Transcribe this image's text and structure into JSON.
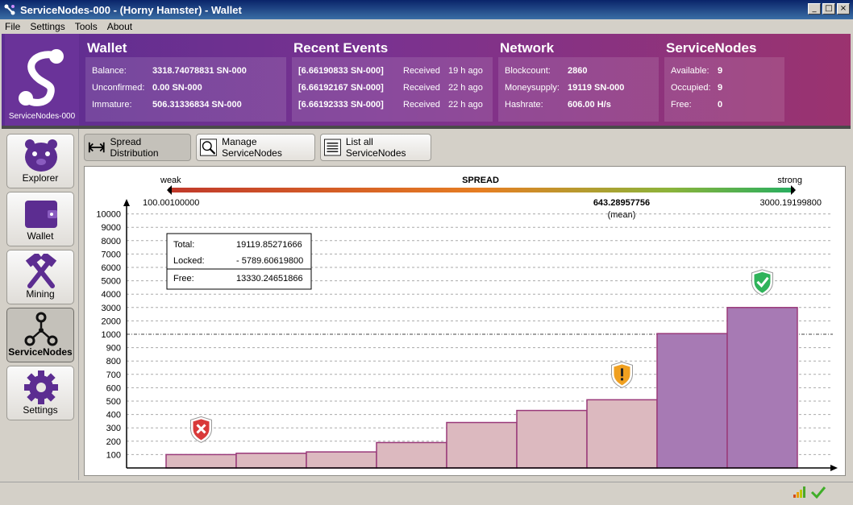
{
  "window": {
    "title": "ServiceNodes-000 - (Horny Hamster) - Wallet"
  },
  "menu": [
    "File",
    "Settings",
    "Tools",
    "About"
  ],
  "logo": {
    "label": "ServiceNodes-000"
  },
  "wallet": {
    "title": "Wallet",
    "rows": [
      {
        "label": "Balance:",
        "value": "3318.74078831 SN-000"
      },
      {
        "label": "Unconfirmed:",
        "value": "0.00 SN-000"
      },
      {
        "label": "Immature:",
        "value": "506.31336834 SN-000"
      }
    ]
  },
  "events": {
    "title": "Recent Events",
    "rows": [
      {
        "amount": "[6.66190833 SN-000]",
        "status": "Received",
        "time": "19 h ago"
      },
      {
        "amount": "[6.66192167 SN-000]",
        "status": "Received",
        "time": "22 h ago"
      },
      {
        "amount": "[6.66192333 SN-000]",
        "status": "Received",
        "time": "22 h ago"
      }
    ]
  },
  "network": {
    "title": "Network",
    "rows": [
      {
        "label": "Blockcount:",
        "value": "2860"
      },
      {
        "label": "Moneysupply:",
        "value": "19119 SN-000"
      },
      {
        "label": "Hashrate:",
        "value": "606.00 H/s"
      }
    ]
  },
  "servicenodes": {
    "title": "ServiceNodes",
    "rows": [
      {
        "label": "Available:",
        "value": "9"
      },
      {
        "label": "Occupied:",
        "value": "9"
      },
      {
        "label": "Free:",
        "value": "0"
      }
    ]
  },
  "sidebar": {
    "items": [
      {
        "label": "Explorer",
        "icon": "hamster-icon"
      },
      {
        "label": "Wallet",
        "icon": "wallet-icon"
      },
      {
        "label": "Mining",
        "icon": "hammers-icon"
      },
      {
        "label": "ServiceNodes",
        "icon": "nodes-icon",
        "active": true
      },
      {
        "label": "Settings",
        "icon": "gear-icon"
      }
    ]
  },
  "toolbar": {
    "spread": "Spread Distribution",
    "manage": "Manage ServiceNodes",
    "list": "List all ServiceNodes"
  },
  "spread": {
    "title": "SPREAD",
    "weak": "weak",
    "strong": "strong",
    "min": "100.00100000",
    "max": "3000.19199800",
    "mean_value": "643.28957756",
    "mean_label": "(mean)"
  },
  "summary": {
    "total_label": "Total:",
    "total_value": "19119.85271666",
    "locked_label": "Locked:",
    "locked_value": "- 5789.60619800",
    "free_label": "Free:",
    "free_value": "13330.24651866"
  },
  "chart_data": {
    "type": "area",
    "y_ticks": [
      "100",
      "200",
      "300",
      "400",
      "500",
      "600",
      "700",
      "800",
      "900",
      "1000",
      "2000",
      "3000",
      "4000",
      "5000",
      "6000",
      "7000",
      "8000",
      "9000",
      "10000"
    ],
    "values": [
      100,
      110,
      120,
      190,
      340,
      430,
      510,
      1050,
      3000
    ],
    "markers": [
      {
        "index": 0,
        "status": "bad"
      },
      {
        "index": 6,
        "status": "warn"
      },
      {
        "index": 8,
        "status": "good"
      }
    ]
  }
}
